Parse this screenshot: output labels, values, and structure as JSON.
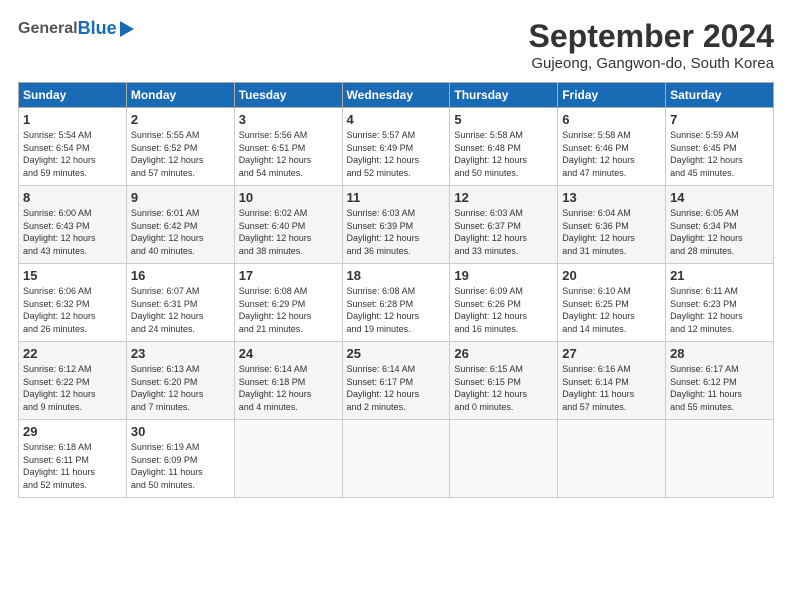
{
  "header": {
    "logo_general": "General",
    "logo_blue": "Blue",
    "title": "September 2024",
    "subtitle": "Gujeong, Gangwon-do, South Korea"
  },
  "weekdays": [
    "Sunday",
    "Monday",
    "Tuesday",
    "Wednesday",
    "Thursday",
    "Friday",
    "Saturday"
  ],
  "weeks": [
    [
      {
        "day": "1",
        "info": "Sunrise: 5:54 AM\nSunset: 6:54 PM\nDaylight: 12 hours\nand 59 minutes."
      },
      {
        "day": "2",
        "info": "Sunrise: 5:55 AM\nSunset: 6:52 PM\nDaylight: 12 hours\nand 57 minutes."
      },
      {
        "day": "3",
        "info": "Sunrise: 5:56 AM\nSunset: 6:51 PM\nDaylight: 12 hours\nand 54 minutes."
      },
      {
        "day": "4",
        "info": "Sunrise: 5:57 AM\nSunset: 6:49 PM\nDaylight: 12 hours\nand 52 minutes."
      },
      {
        "day": "5",
        "info": "Sunrise: 5:58 AM\nSunset: 6:48 PM\nDaylight: 12 hours\nand 50 minutes."
      },
      {
        "day": "6",
        "info": "Sunrise: 5:58 AM\nSunset: 6:46 PM\nDaylight: 12 hours\nand 47 minutes."
      },
      {
        "day": "7",
        "info": "Sunrise: 5:59 AM\nSunset: 6:45 PM\nDaylight: 12 hours\nand 45 minutes."
      }
    ],
    [
      {
        "day": "8",
        "info": "Sunrise: 6:00 AM\nSunset: 6:43 PM\nDaylight: 12 hours\nand 43 minutes."
      },
      {
        "day": "9",
        "info": "Sunrise: 6:01 AM\nSunset: 6:42 PM\nDaylight: 12 hours\nand 40 minutes."
      },
      {
        "day": "10",
        "info": "Sunrise: 6:02 AM\nSunset: 6:40 PM\nDaylight: 12 hours\nand 38 minutes."
      },
      {
        "day": "11",
        "info": "Sunrise: 6:03 AM\nSunset: 6:39 PM\nDaylight: 12 hours\nand 36 minutes."
      },
      {
        "day": "12",
        "info": "Sunrise: 6:03 AM\nSunset: 6:37 PM\nDaylight: 12 hours\nand 33 minutes."
      },
      {
        "day": "13",
        "info": "Sunrise: 6:04 AM\nSunset: 6:36 PM\nDaylight: 12 hours\nand 31 minutes."
      },
      {
        "day": "14",
        "info": "Sunrise: 6:05 AM\nSunset: 6:34 PM\nDaylight: 12 hours\nand 28 minutes."
      }
    ],
    [
      {
        "day": "15",
        "info": "Sunrise: 6:06 AM\nSunset: 6:32 PM\nDaylight: 12 hours\nand 26 minutes."
      },
      {
        "day": "16",
        "info": "Sunrise: 6:07 AM\nSunset: 6:31 PM\nDaylight: 12 hours\nand 24 minutes."
      },
      {
        "day": "17",
        "info": "Sunrise: 6:08 AM\nSunset: 6:29 PM\nDaylight: 12 hours\nand 21 minutes."
      },
      {
        "day": "18",
        "info": "Sunrise: 6:08 AM\nSunset: 6:28 PM\nDaylight: 12 hours\nand 19 minutes."
      },
      {
        "day": "19",
        "info": "Sunrise: 6:09 AM\nSunset: 6:26 PM\nDaylight: 12 hours\nand 16 minutes."
      },
      {
        "day": "20",
        "info": "Sunrise: 6:10 AM\nSunset: 6:25 PM\nDaylight: 12 hours\nand 14 minutes."
      },
      {
        "day": "21",
        "info": "Sunrise: 6:11 AM\nSunset: 6:23 PM\nDaylight: 12 hours\nand 12 minutes."
      }
    ],
    [
      {
        "day": "22",
        "info": "Sunrise: 6:12 AM\nSunset: 6:22 PM\nDaylight: 12 hours\nand 9 minutes."
      },
      {
        "day": "23",
        "info": "Sunrise: 6:13 AM\nSunset: 6:20 PM\nDaylight: 12 hours\nand 7 minutes."
      },
      {
        "day": "24",
        "info": "Sunrise: 6:14 AM\nSunset: 6:18 PM\nDaylight: 12 hours\nand 4 minutes."
      },
      {
        "day": "25",
        "info": "Sunrise: 6:14 AM\nSunset: 6:17 PM\nDaylight: 12 hours\nand 2 minutes."
      },
      {
        "day": "26",
        "info": "Sunrise: 6:15 AM\nSunset: 6:15 PM\nDaylight: 12 hours\nand 0 minutes."
      },
      {
        "day": "27",
        "info": "Sunrise: 6:16 AM\nSunset: 6:14 PM\nDaylight: 11 hours\nand 57 minutes."
      },
      {
        "day": "28",
        "info": "Sunrise: 6:17 AM\nSunset: 6:12 PM\nDaylight: 11 hours\nand 55 minutes."
      }
    ],
    [
      {
        "day": "29",
        "info": "Sunrise: 6:18 AM\nSunset: 6:11 PM\nDaylight: 11 hours\nand 52 minutes."
      },
      {
        "day": "30",
        "info": "Sunrise: 6:19 AM\nSunset: 6:09 PM\nDaylight: 11 hours\nand 50 minutes."
      },
      {
        "day": "",
        "info": ""
      },
      {
        "day": "",
        "info": ""
      },
      {
        "day": "",
        "info": ""
      },
      {
        "day": "",
        "info": ""
      },
      {
        "day": "",
        "info": ""
      }
    ]
  ]
}
